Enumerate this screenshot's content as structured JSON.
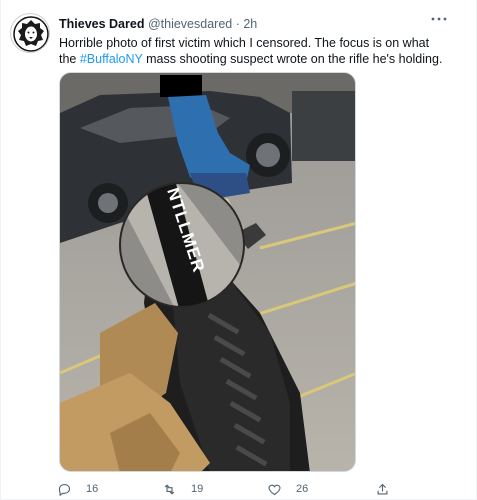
{
  "tweet": {
    "display_name": "Thieves Dared",
    "handle": "@thievesdared",
    "separator": "·",
    "time": "2h",
    "text_part1": "Horrible photo of first victim which I censored. The focus is on what the ",
    "hashtag": "#BuffaloNY",
    "text_part2": " mass shooting suspect wrote on the rifle he's holding.",
    "more_icon": "more-horizontal-icon"
  },
  "media": {
    "rifle_text": "NTLLMER"
  },
  "actions": {
    "replies": "16",
    "retweets": "19",
    "likes": "26"
  },
  "colors": {
    "accent": "#1d9bf0",
    "secondary_text": "#536471",
    "primary_text": "#0f1419"
  }
}
